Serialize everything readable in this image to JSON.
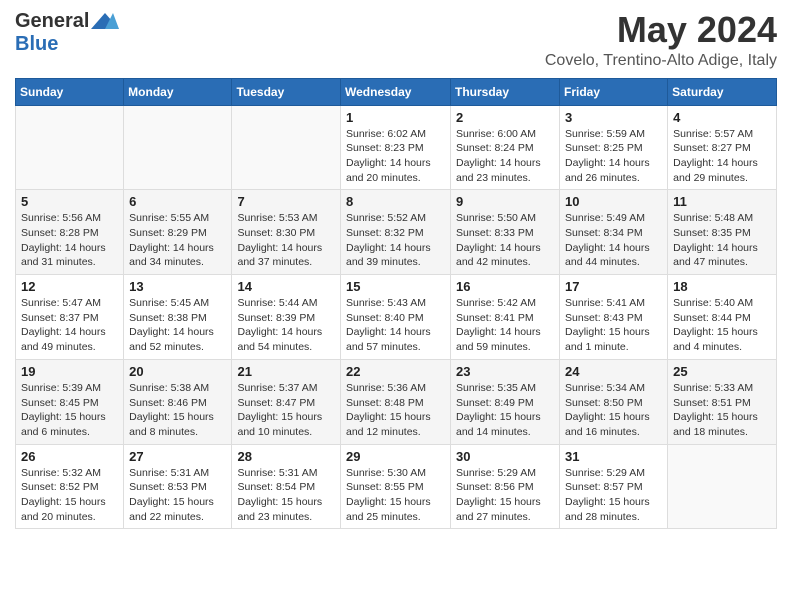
{
  "logo": {
    "general": "General",
    "blue": "Blue"
  },
  "title": "May 2024",
  "location": "Covelo, Trentino-Alto Adige, Italy",
  "days_header": [
    "Sunday",
    "Monday",
    "Tuesday",
    "Wednesday",
    "Thursday",
    "Friday",
    "Saturday"
  ],
  "weeks": [
    [
      {
        "day": "",
        "sunrise": "",
        "sunset": "",
        "daylight": ""
      },
      {
        "day": "",
        "sunrise": "",
        "sunset": "",
        "daylight": ""
      },
      {
        "day": "",
        "sunrise": "",
        "sunset": "",
        "daylight": ""
      },
      {
        "day": "1",
        "sunrise": "Sunrise: 6:02 AM",
        "sunset": "Sunset: 8:23 PM",
        "daylight": "Daylight: 14 hours and 20 minutes."
      },
      {
        "day": "2",
        "sunrise": "Sunrise: 6:00 AM",
        "sunset": "Sunset: 8:24 PM",
        "daylight": "Daylight: 14 hours and 23 minutes."
      },
      {
        "day": "3",
        "sunrise": "Sunrise: 5:59 AM",
        "sunset": "Sunset: 8:25 PM",
        "daylight": "Daylight: 14 hours and 26 minutes."
      },
      {
        "day": "4",
        "sunrise": "Sunrise: 5:57 AM",
        "sunset": "Sunset: 8:27 PM",
        "daylight": "Daylight: 14 hours and 29 minutes."
      }
    ],
    [
      {
        "day": "5",
        "sunrise": "Sunrise: 5:56 AM",
        "sunset": "Sunset: 8:28 PM",
        "daylight": "Daylight: 14 hours and 31 minutes."
      },
      {
        "day": "6",
        "sunrise": "Sunrise: 5:55 AM",
        "sunset": "Sunset: 8:29 PM",
        "daylight": "Daylight: 14 hours and 34 minutes."
      },
      {
        "day": "7",
        "sunrise": "Sunrise: 5:53 AM",
        "sunset": "Sunset: 8:30 PM",
        "daylight": "Daylight: 14 hours and 37 minutes."
      },
      {
        "day": "8",
        "sunrise": "Sunrise: 5:52 AM",
        "sunset": "Sunset: 8:32 PM",
        "daylight": "Daylight: 14 hours and 39 minutes."
      },
      {
        "day": "9",
        "sunrise": "Sunrise: 5:50 AM",
        "sunset": "Sunset: 8:33 PM",
        "daylight": "Daylight: 14 hours and 42 minutes."
      },
      {
        "day": "10",
        "sunrise": "Sunrise: 5:49 AM",
        "sunset": "Sunset: 8:34 PM",
        "daylight": "Daylight: 14 hours and 44 minutes."
      },
      {
        "day": "11",
        "sunrise": "Sunrise: 5:48 AM",
        "sunset": "Sunset: 8:35 PM",
        "daylight": "Daylight: 14 hours and 47 minutes."
      }
    ],
    [
      {
        "day": "12",
        "sunrise": "Sunrise: 5:47 AM",
        "sunset": "Sunset: 8:37 PM",
        "daylight": "Daylight: 14 hours and 49 minutes."
      },
      {
        "day": "13",
        "sunrise": "Sunrise: 5:45 AM",
        "sunset": "Sunset: 8:38 PM",
        "daylight": "Daylight: 14 hours and 52 minutes."
      },
      {
        "day": "14",
        "sunrise": "Sunrise: 5:44 AM",
        "sunset": "Sunset: 8:39 PM",
        "daylight": "Daylight: 14 hours and 54 minutes."
      },
      {
        "day": "15",
        "sunrise": "Sunrise: 5:43 AM",
        "sunset": "Sunset: 8:40 PM",
        "daylight": "Daylight: 14 hours and 57 minutes."
      },
      {
        "day": "16",
        "sunrise": "Sunrise: 5:42 AM",
        "sunset": "Sunset: 8:41 PM",
        "daylight": "Daylight: 14 hours and 59 minutes."
      },
      {
        "day": "17",
        "sunrise": "Sunrise: 5:41 AM",
        "sunset": "Sunset: 8:43 PM",
        "daylight": "Daylight: 15 hours and 1 minute."
      },
      {
        "day": "18",
        "sunrise": "Sunrise: 5:40 AM",
        "sunset": "Sunset: 8:44 PM",
        "daylight": "Daylight: 15 hours and 4 minutes."
      }
    ],
    [
      {
        "day": "19",
        "sunrise": "Sunrise: 5:39 AM",
        "sunset": "Sunset: 8:45 PM",
        "daylight": "Daylight: 15 hours and 6 minutes."
      },
      {
        "day": "20",
        "sunrise": "Sunrise: 5:38 AM",
        "sunset": "Sunset: 8:46 PM",
        "daylight": "Daylight: 15 hours and 8 minutes."
      },
      {
        "day": "21",
        "sunrise": "Sunrise: 5:37 AM",
        "sunset": "Sunset: 8:47 PM",
        "daylight": "Daylight: 15 hours and 10 minutes."
      },
      {
        "day": "22",
        "sunrise": "Sunrise: 5:36 AM",
        "sunset": "Sunset: 8:48 PM",
        "daylight": "Daylight: 15 hours and 12 minutes."
      },
      {
        "day": "23",
        "sunrise": "Sunrise: 5:35 AM",
        "sunset": "Sunset: 8:49 PM",
        "daylight": "Daylight: 15 hours and 14 minutes."
      },
      {
        "day": "24",
        "sunrise": "Sunrise: 5:34 AM",
        "sunset": "Sunset: 8:50 PM",
        "daylight": "Daylight: 15 hours and 16 minutes."
      },
      {
        "day": "25",
        "sunrise": "Sunrise: 5:33 AM",
        "sunset": "Sunset: 8:51 PM",
        "daylight": "Daylight: 15 hours and 18 minutes."
      }
    ],
    [
      {
        "day": "26",
        "sunrise": "Sunrise: 5:32 AM",
        "sunset": "Sunset: 8:52 PM",
        "daylight": "Daylight: 15 hours and 20 minutes."
      },
      {
        "day": "27",
        "sunrise": "Sunrise: 5:31 AM",
        "sunset": "Sunset: 8:53 PM",
        "daylight": "Daylight: 15 hours and 22 minutes."
      },
      {
        "day": "28",
        "sunrise": "Sunrise: 5:31 AM",
        "sunset": "Sunset: 8:54 PM",
        "daylight": "Daylight: 15 hours and 23 minutes."
      },
      {
        "day": "29",
        "sunrise": "Sunrise: 5:30 AM",
        "sunset": "Sunset: 8:55 PM",
        "daylight": "Daylight: 15 hours and 25 minutes."
      },
      {
        "day": "30",
        "sunrise": "Sunrise: 5:29 AM",
        "sunset": "Sunset: 8:56 PM",
        "daylight": "Daylight: 15 hours and 27 minutes."
      },
      {
        "day": "31",
        "sunrise": "Sunrise: 5:29 AM",
        "sunset": "Sunset: 8:57 PM",
        "daylight": "Daylight: 15 hours and 28 minutes."
      },
      {
        "day": "",
        "sunrise": "",
        "sunset": "",
        "daylight": ""
      }
    ]
  ]
}
